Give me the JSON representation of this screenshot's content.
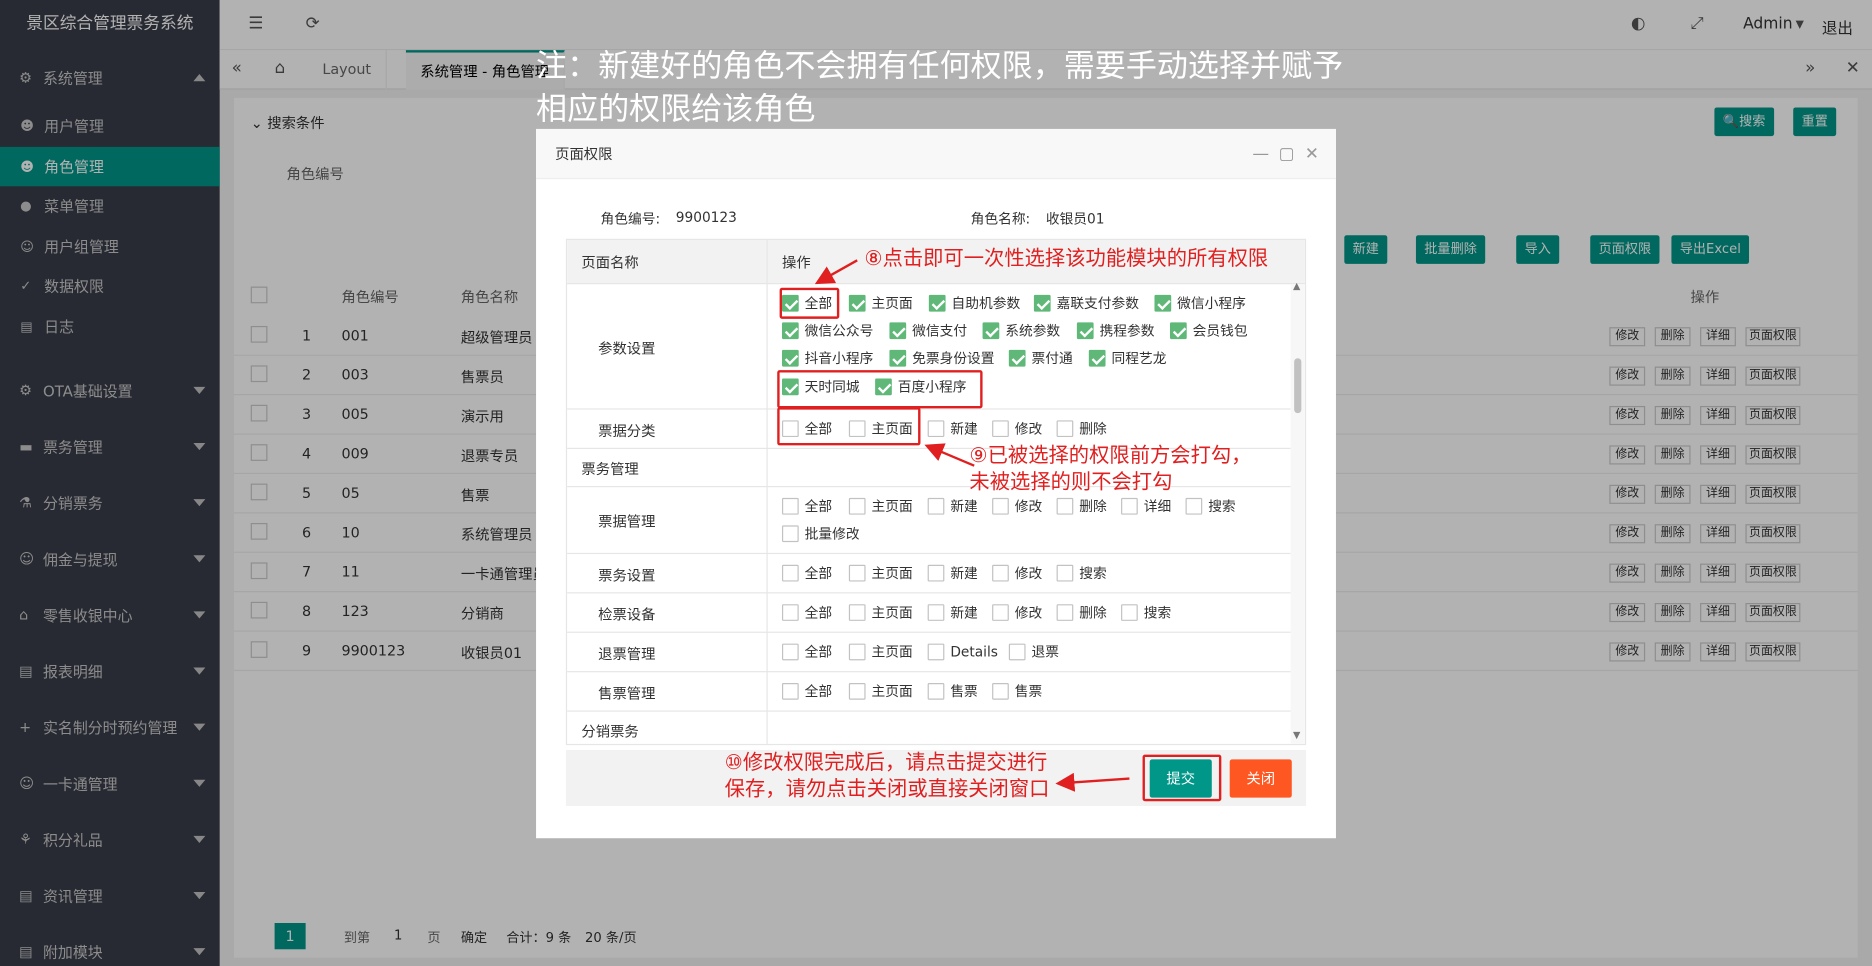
{
  "app": {
    "title": "景区综合管理票务系统",
    "admin": "Admin",
    "logout": "退出"
  },
  "sidebar": {
    "groups": [
      {
        "label": "系统管理",
        "icon": "gear-icon",
        "expanded": true
      },
      {
        "label": "OTA基础设置",
        "icon": "gear-icon"
      },
      {
        "label": "票务管理",
        "icon": "ticket-icon"
      },
      {
        "label": "分销票务",
        "icon": "share-icon"
      },
      {
        "label": "佣金与提现",
        "icon": "user-icon"
      },
      {
        "label": "零售收银中心",
        "icon": "store-icon"
      },
      {
        "label": "报表明细",
        "icon": "report-icon"
      },
      {
        "label": "实名制分时预约管理",
        "icon": "plus-icon"
      },
      {
        "label": "一卡通管理",
        "icon": "card-icon"
      },
      {
        "label": "积分礼品",
        "icon": "gift-icon"
      },
      {
        "label": "资讯管理",
        "icon": "news-icon"
      },
      {
        "label": "附加模块",
        "icon": "module-icon"
      }
    ],
    "sub": [
      "用户管理",
      "角色管理",
      "菜单管理",
      "用户组管理",
      "数据权限",
      "日志"
    ]
  },
  "tabs": [
    "Layout",
    "系统管理 - 角色管理"
  ],
  "search": {
    "title": "搜索条件",
    "field": "角色编号",
    "search_btn": "搜索",
    "reset_btn": "重置"
  },
  "toolbar": [
    "新建",
    "批量删除",
    "导入",
    "页面权限",
    "导出Excel"
  ],
  "table": {
    "headers": [
      "角色编号",
      "角色名称",
      "操作"
    ],
    "rows": [
      [
        "1",
        "001",
        "超级管理员"
      ],
      [
        "2",
        "003",
        "售票员"
      ],
      [
        "3",
        "005",
        "演示用"
      ],
      [
        "4",
        "009",
        "退票专员"
      ],
      [
        "5",
        "05",
        "售票"
      ],
      [
        "6",
        "10",
        "系统管理员"
      ],
      [
        "7",
        "11",
        "一卡通管理员"
      ],
      [
        "8",
        "123",
        "分销商"
      ],
      [
        "9",
        "9900123",
        "收银员01"
      ]
    ],
    "ops": [
      "修改",
      "删除",
      "详细",
      "页面权限"
    ]
  },
  "pager": {
    "page": "1",
    "goto": "到第",
    "page_input": "1",
    "page_unit": "页",
    "confirm": "确定",
    "total": "合计：9 条",
    "per_page": "20 条/页"
  },
  "annotation_top": "注：新建好的角色不会拥有任何权限，需要手动选择并赋予相应的权限给该角色",
  "dialog": {
    "title": "页面权限",
    "role_id_label": "角色编号:",
    "role_id": "9900123",
    "role_name_label": "角色名称:",
    "role_name": "收银员01",
    "col_page": "页面名称",
    "col_op": "操作",
    "rows": [
      {
        "name": "参数设置",
        "perms": [
          {
            "l": "全部",
            "on": true
          },
          {
            "l": "主页面",
            "on": true
          },
          {
            "l": "自助机参数",
            "on": true
          },
          {
            "l": "嘉联支付参数",
            "on": true
          },
          {
            "l": "微信小程序",
            "on": true
          },
          {
            "l": "微信公众号",
            "on": true
          },
          {
            "l": "微信支付",
            "on": true
          },
          {
            "l": "系统参数",
            "on": true
          },
          {
            "l": "携程参数",
            "on": true
          },
          {
            "l": "会员钱包",
            "on": true
          },
          {
            "l": "抖音小程序",
            "on": true
          },
          {
            "l": "免票身份设置",
            "on": true
          },
          {
            "l": "票付通",
            "on": true
          },
          {
            "l": "同程艺龙",
            "on": true
          },
          {
            "l": "天时同城",
            "on": true
          },
          {
            "l": "百度小程序",
            "on": true
          }
        ]
      },
      {
        "name": "票据分类",
        "perms": [
          {
            "l": "全部"
          },
          {
            "l": "主页面"
          },
          {
            "l": "新建"
          },
          {
            "l": "修改"
          },
          {
            "l": "删除"
          }
        ]
      },
      {
        "name": "票务管理",
        "group": true,
        "perms": []
      },
      {
        "name": "票据管理",
        "perms": [
          {
            "l": "全部"
          },
          {
            "l": "主页面"
          },
          {
            "l": "新建"
          },
          {
            "l": "修改"
          },
          {
            "l": "删除"
          },
          {
            "l": "详细"
          },
          {
            "l": "搜索"
          },
          {
            "l": "批量修改"
          }
        ]
      },
      {
        "name": "票务设置",
        "perms": [
          {
            "l": "全部"
          },
          {
            "l": "主页面"
          },
          {
            "l": "新建"
          },
          {
            "l": "修改"
          },
          {
            "l": "搜索"
          }
        ]
      },
      {
        "name": "检票设备",
        "perms": [
          {
            "l": "全部"
          },
          {
            "l": "主页面"
          },
          {
            "l": "新建"
          },
          {
            "l": "修改"
          },
          {
            "l": "删除"
          },
          {
            "l": "搜索"
          }
        ]
      },
      {
        "name": "退票管理",
        "perms": [
          {
            "l": "全部"
          },
          {
            "l": "主页面"
          },
          {
            "l": "Details"
          },
          {
            "l": "退票"
          }
        ]
      },
      {
        "name": "售票管理",
        "perms": [
          {
            "l": "全部"
          },
          {
            "l": "主页面"
          },
          {
            "l": "售票"
          },
          {
            "l": "售票"
          }
        ]
      },
      {
        "name": "分销票务",
        "group": true,
        "perms": []
      }
    ],
    "submit": "提交",
    "close": "关闭"
  },
  "annotations": {
    "a8": "⑧点击即可一次性选择该功能模块的所有权限",
    "a9_1": "⑨已被选择的权限前方会打勾，",
    "a9_2": "未被选择的则不会打勾",
    "a10_1": "⑩修改权限完成后，请点击提交进行",
    "a10_2": "保存，请勿点击关闭或直接关闭窗口"
  },
  "colors": {
    "accent": "#009688",
    "check": "#5fb878",
    "red": "#e02020",
    "close_btn": "#ff5722"
  }
}
